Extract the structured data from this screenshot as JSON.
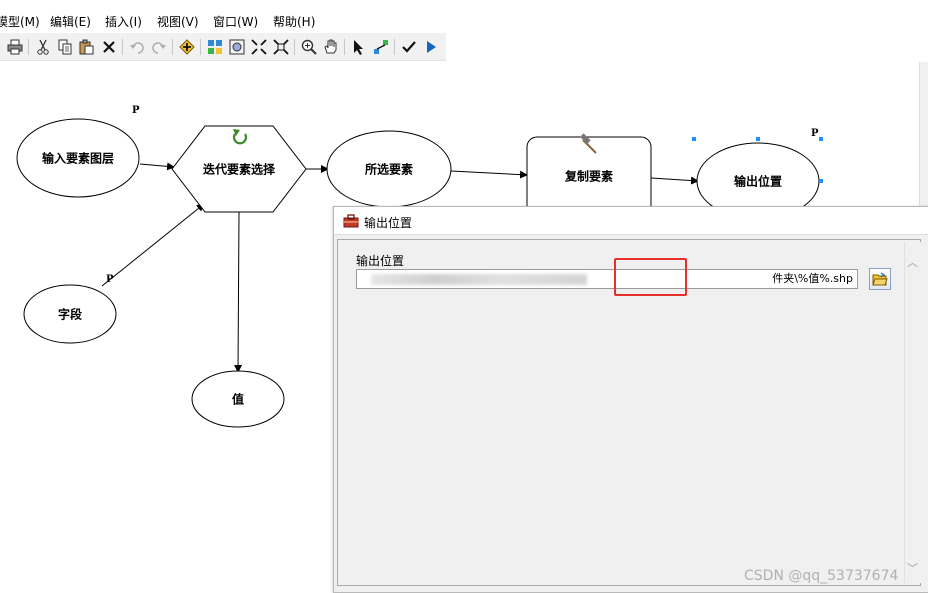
{
  "menu": {
    "items": [
      "模型(M)",
      "编辑(E)",
      "插入(I)",
      "视图(V)",
      "窗口(W)",
      "帮助(H)"
    ]
  },
  "toolbar": {
    "icons": [
      "print-icon",
      "cut-icon",
      "copy-icon",
      "paste-icon",
      "delete-icon",
      "undo-icon",
      "redo-icon",
      "add-data-icon",
      "auto-layout-icon",
      "full-extent-icon",
      "zoom-in-fixed-icon",
      "zoom-out-fixed-icon",
      "zoom-in-icon",
      "pan-icon",
      "select-icon",
      "add-connection-icon",
      "validate-icon",
      "run-icon"
    ]
  },
  "model": {
    "nodes": {
      "input_layer": "输入要素图层",
      "iterate": "迭代要素选择",
      "selected": "所选要素",
      "copy": "复制要素",
      "output": "输出位置",
      "field": "字段",
      "value": "值"
    },
    "param_marker": "P"
  },
  "dialog": {
    "title": "输出位置",
    "field_label": "输出位置",
    "path_value": "件夹\\%值%.shp"
  },
  "watermark": "CSDN @qq_53737674",
  "colors": {
    "highlight": "#e8302b",
    "selection_handle": "#1e90ff",
    "run_arrow": "#1565c0"
  }
}
